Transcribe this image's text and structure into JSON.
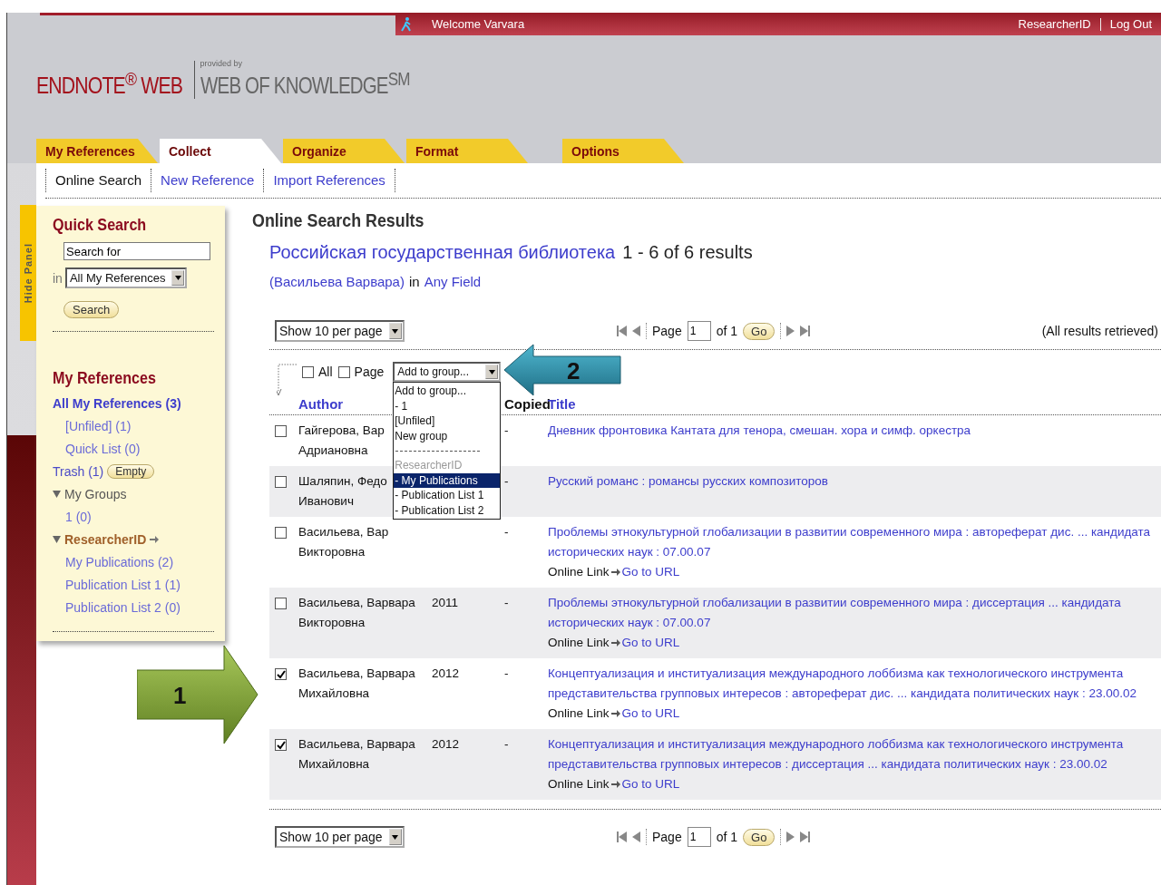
{
  "top_bar": {
    "welcome": "Welcome Varvara",
    "links": [
      "ResearcherID",
      "Log Out"
    ]
  },
  "logo": {
    "product": "ENDNOTE$^{®}$ WEB",
    "provided_by": "provided by",
    "partner": "WEB OF KNOWLEDGE$^{SM}$"
  },
  "tabs": [
    {
      "label": "My References",
      "selected": false
    },
    {
      "label": "Collect",
      "selected": true
    },
    {
      "label": "Organize",
      "selected": false
    },
    {
      "label": "Format",
      "selected": false
    },
    {
      "label": "Options",
      "selected": false
    }
  ],
  "subtabs": [
    {
      "label": "Online Search",
      "selected": true
    },
    {
      "label": "New Reference",
      "selected": false
    },
    {
      "label": "Import References",
      "selected": false
    }
  ],
  "hide_panel": "Hide Panel",
  "quick_search": {
    "title": "Quick Search",
    "value": "Search for",
    "in_label": "in",
    "scope": "All My References",
    "button": "Search"
  },
  "my_references": {
    "title": "My References",
    "items": [
      {
        "label": "All My References (3)",
        "kind": "all",
        "children": [
          {
            "label": "[Unfiled] (1)"
          },
          {
            "label": "Quick List (0)"
          }
        ]
      },
      {
        "label": "Trash (1)",
        "kind": "trash",
        "button": "Empty"
      },
      {
        "label": "My Groups",
        "kind": "group",
        "expanded": true,
        "children": [
          {
            "label": "1 (0)"
          }
        ]
      },
      {
        "label": "ResearcherID",
        "kind": "external",
        "expanded": true,
        "children": [
          {
            "label": "My Publications (2)"
          },
          {
            "label": "Publication List 1 (1)"
          },
          {
            "label": "Publication List 2 (0)"
          }
        ]
      }
    ]
  },
  "results": {
    "title": "Online Search Results",
    "source": "Российская государственная библиотека",
    "count": "1 - 6 of 6 results",
    "query": "(Васильева Варвара)",
    "in_label": "in",
    "field": "Any Field"
  },
  "pager_top": {
    "per_page": "Show 10 per page",
    "page_label": "Page",
    "page": "1",
    "of": "of 1",
    "go": "Go",
    "status": "(All results retrieved)"
  },
  "toolbar": {
    "all_label": "All",
    "all_checked": false,
    "page_label": "Page",
    "page_checked": false,
    "group_select": "Add to group...",
    "callout": "2",
    "dropdown": [
      {
        "kind": "option",
        "label": "Add to group...",
        "selected": false
      },
      {
        "kind": "option",
        "label": "- 1",
        "selected": false
      },
      {
        "kind": "option",
        "label": "[Unfiled]",
        "selected": false
      },
      {
        "kind": "option",
        "label": "New group",
        "selected": false
      },
      {
        "kind": "divider"
      },
      {
        "kind": "header",
        "label": "ResearcherID"
      },
      {
        "kind": "option",
        "label": "- My Publications",
        "selected": true
      },
      {
        "kind": "option",
        "label": "- Publication List 1",
        "selected": false
      },
      {
        "kind": "option",
        "label": "- Publication List 2",
        "selected": false
      }
    ]
  },
  "columns": [
    {
      "label": "Author",
      "kind": "sortable"
    },
    {
      "label": "Copied",
      "kind": "plain"
    },
    {
      "label": "Title",
      "kind": "sortable"
    }
  ],
  "rows": [
    {
      "checked": false,
      "author": "Гайгерова, Вар\nАдриановна",
      "copied": "-",
      "title": "Дневник фронтовика Кантата для тенора, смешан. хора и симф. оркестра"
    },
    {
      "checked": false,
      "author": "Шаляпин, Федо\nИванович",
      "copied": "-",
      "title": "Русский романс : романсы русских композиторов"
    },
    {
      "checked": false,
      "author": "Васильева, Вар\nВикторовна",
      "copied": "-",
      "title": "Проблемы этнокультурной глобализации в развитии современного мира : автореферат дис. ... кандидата исторических наук : 07.00.07",
      "link": {
        "label": "Online Link",
        "action": "Go to URL"
      }
    },
    {
      "checked": false,
      "author": "Васильева, Варвара\nВикторовна",
      "year": "2011",
      "copied": "-",
      "title": "Проблемы этнокультурной глобализации в развитии современного мира : диссертация ... кандидата исторических наук : 07.00.07",
      "link": {
        "label": "Online Link",
        "action": "Go to URL"
      }
    },
    {
      "checked": true,
      "author": "Васильева, Варвара\nМихайловна",
      "year": "2012",
      "copied": "-",
      "title": "Концептуализация и институализация международного лоббизма как технологического инструмента представительства групповых интересов : автореферат дис. ... кандидата политических наук : 23.00.02",
      "link": {
        "label": "Online Link",
        "action": "Go to URL"
      },
      "callout": "1"
    },
    {
      "checked": true,
      "author": "Васильева, Варвара\nМихайловна",
      "year": "2012",
      "copied": "-",
      "title": "Концептуализация и институализация международного лоббизма как технологического инструмента представительства групповых интересов : диссертация ... кандидата политических наук : 23.00.02",
      "link": {
        "label": "Online Link",
        "action": "Go to URL"
      }
    }
  ],
  "pager_bottom": {
    "per_page": "Show 10 per page",
    "page_label": "Page",
    "page": "1",
    "of": "of 1",
    "go": "Go"
  }
}
